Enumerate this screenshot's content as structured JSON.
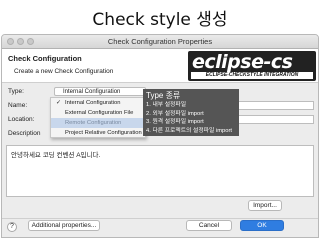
{
  "slide": {
    "title": "Check style 생성"
  },
  "window": {
    "title": "Check Configuration Properties"
  },
  "header": {
    "title": "Check Configuration",
    "subtitle": "Create a new Check Configuration",
    "logo_text": "eclipse-cs",
    "logo_tagline": "ECLIPSE-CHECKSTYLE INTEGRATION"
  },
  "form": {
    "type_label": "Type:",
    "name_label": "Name:",
    "location_label": "Location:",
    "description_label": "Description",
    "type_value": "Internal Configuration",
    "description_value": "안녕하세요 코딩 컨벤션 A입니다."
  },
  "dropdown": {
    "items": [
      {
        "label": "Internal Configuration",
        "checked": true
      },
      {
        "label": "External Configuration File"
      },
      {
        "label": "Remote Configuration"
      },
      {
        "label": "Project Relative Configuration"
      }
    ]
  },
  "annotation": {
    "title": "Type 종류",
    "lines": [
      "1. 내부 설정파일",
      "2. 외부 설정파일 import",
      "3. 원격 설정파일 import",
      "4. 다른 프로젝트의 설정파일 import"
    ]
  },
  "buttons": {
    "import": "Import...",
    "additional": "Additional properties...",
    "help": "?",
    "cancel": "Cancel",
    "ok": "OK"
  },
  "colors": {
    "ok_button": "#2f7de1",
    "annotation_bg": "#555555"
  }
}
